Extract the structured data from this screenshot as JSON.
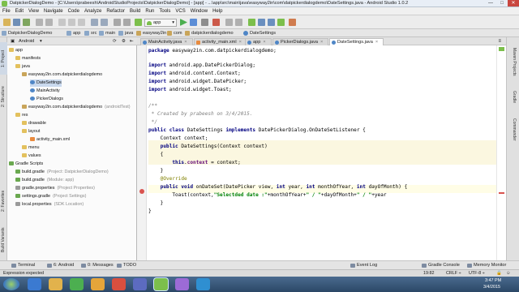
{
  "window": {
    "title": "DatpickerDialogDemo - [C:\\Users\\prabeesh\\AndroidStudioProjects\\DatpickerDialogDemo] - [app] - ...\\app\\src\\main\\java\\easyway2in\\com\\datpickerdialogdemo\\DateSettings.java - Android Studio 1.0.2",
    "minimize": "—",
    "maximize": "□",
    "close": "✕"
  },
  "menu": [
    "File",
    "Edit",
    "View",
    "Navigate",
    "Code",
    "Analyze",
    "Refactor",
    "Build",
    "Run",
    "Tools",
    "VCS",
    "Window",
    "Help"
  ],
  "toolbar": {
    "run_config": "app"
  },
  "breadcrumbs": [
    "DatpickerDialogDemo",
    "app",
    "src",
    "main",
    "java",
    "easyway2in",
    "com",
    "datpickerdialogdemo",
    "DateSettings"
  ],
  "project_panel": {
    "view_selector": "Android",
    "items": [
      {
        "label": "app",
        "hint": "",
        "icon": "fold"
      },
      {
        "label": "manifests",
        "hint": "",
        "icon": "fold"
      },
      {
        "label": "java",
        "hint": "",
        "icon": "fold"
      },
      {
        "label": "easyway2in.com.datpickerdialogdemo",
        "hint": "",
        "icon": "pk"
      },
      {
        "label": "DateSettings",
        "hint": "",
        "icon": "cl"
      },
      {
        "label": "MainActivity",
        "hint": "",
        "icon": "cl"
      },
      {
        "label": "PickerDialogs",
        "hint": "",
        "icon": "cl"
      },
      {
        "label": "easyway2in.com.datpickerdialogdemo",
        "hint": "(androidTest)",
        "icon": "pk"
      },
      {
        "label": "res",
        "hint": "",
        "icon": "fold"
      },
      {
        "label": "drawable",
        "hint": "",
        "icon": "fold"
      },
      {
        "label": "layout",
        "hint": "",
        "icon": "fold"
      },
      {
        "label": "activity_main.xml",
        "hint": "",
        "icon": "xml"
      },
      {
        "label": "menu",
        "hint": "",
        "icon": "fold"
      },
      {
        "label": "values",
        "hint": "",
        "icon": "fold"
      },
      {
        "label": "Gradle Scripts",
        "hint": "",
        "icon": "grd"
      },
      {
        "label": "build.gradle",
        "hint": "(Project: DatpickerDialogDemo)",
        "icon": "grd"
      },
      {
        "label": "build.gradle",
        "hint": "(Module: app)",
        "icon": "grd"
      },
      {
        "label": "gradle.properties",
        "hint": "(Project Properties)",
        "icon": "prop"
      },
      {
        "label": "settings.gradle",
        "hint": "(Project Settings)",
        "icon": "grd"
      },
      {
        "label": "local.properties",
        "hint": "(SDK Location)",
        "icon": "prop"
      }
    ]
  },
  "editor_tabs": [
    {
      "label": "MainActivity.java",
      "kind": "java",
      "close": "×"
    },
    {
      "label": "activity_main.xml",
      "kind": "xml",
      "close": "×"
    },
    {
      "label": "app",
      "kind": "gradle",
      "close": "×"
    },
    {
      "label": "PickerDialogs.java",
      "kind": "java",
      "close": "×"
    },
    {
      "label": "DateSettings.java",
      "kind": "java",
      "close": "×"
    }
  ],
  "code": {
    "l1": "package easyway2in.com.datpickerdialogdemo;",
    "l3": "import android.app.DatePickerDialog;",
    "l4": "import android.content.Context;",
    "l5": "import android.widget.DatePicker;",
    "l6": "import android.widget.Toast;",
    "l8": "/**",
    "l9": " * Created by prabeesh on 3/4/2015.",
    "l10": " */",
    "l11": "public class DateSettings implements DatePickerDialog.OnDateSetListener {",
    "l12": "    Context context;",
    "l13": "    public DateSettings(Context context)",
    "l14": "    {",
    "l15": "        this.context = context;",
    "l16": "    }",
    "l17": "    @Override",
    "l18": "    public void onDateSet(DatePicker view, int year, int monthOfYear, int dayOfMonth) {",
    "l19": "        Toast(context,\"Selectded date :\"+monthOfYear+\" / \"+dayOfMonth+\" / \"+year",
    "l20": "    }",
    "l21": "}"
  },
  "right_tools": [
    "Maven Projects",
    "Gradle",
    "Commander"
  ],
  "left_tools": [
    "1: Project",
    "2: Structure",
    "2: Favorites",
    "Build Variants"
  ],
  "bottom_tools": [
    "Terminal",
    "6: Android",
    "0: Messages",
    "TODO",
    "Event Log",
    "Gradle Console",
    "Memory Monitor"
  ],
  "status": {
    "message": "Expression expected",
    "position": "19:82",
    "line_sep": "CRLF ÷",
    "encoding": "UTF-8 ÷"
  },
  "clock": {
    "time": "3:47 PM",
    "date": "3/4/2015"
  }
}
